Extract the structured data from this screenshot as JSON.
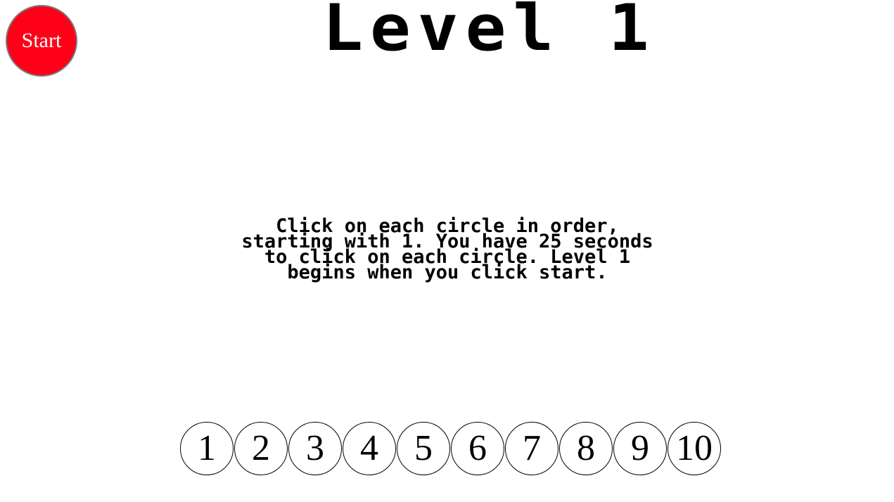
{
  "start_button": {
    "label": "Start",
    "color": "#ff0019"
  },
  "title": "Level 1",
  "instructions": {
    "lines": [
      "Click on each circle in order,",
      "starting with 1. You have 25 seconds",
      "to click on each circle. Level 1",
      "begins when you click start."
    ]
  },
  "circles": [
    "1",
    "2",
    "3",
    "4",
    "5",
    "6",
    "7",
    "8",
    "9",
    "10"
  ]
}
